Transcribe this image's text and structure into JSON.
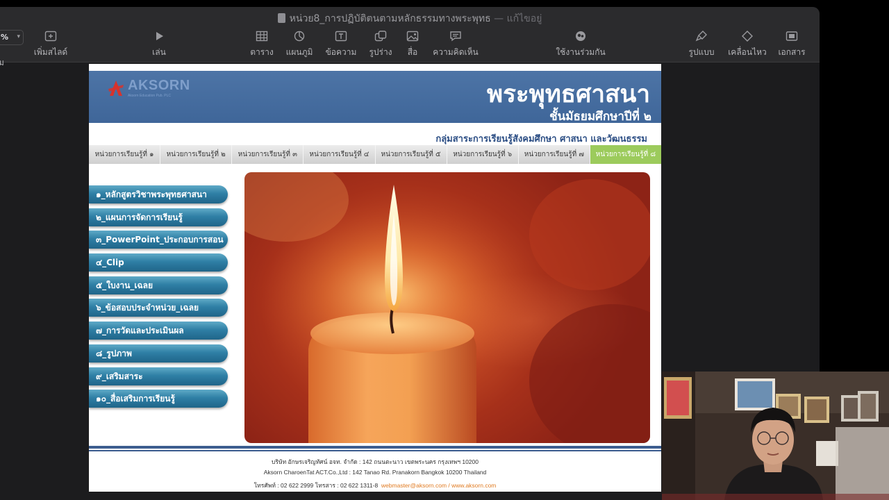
{
  "window": {
    "title": "หน่วย8_การปฏิบัติตนตามหลักธรรมทางพระพุทธ",
    "edited": "— แก้ไขอยู่"
  },
  "toolbar": {
    "zoom_value": "%",
    "zoom_label": "ม",
    "items": [
      {
        "label": "เพิ่มสไลด์",
        "icon": "add-slide-icon"
      },
      {
        "label": "เล่น",
        "icon": "play-icon"
      },
      {
        "label": "ตาราง",
        "icon": "table-icon"
      },
      {
        "label": "แผนภูมิ",
        "icon": "chart-icon"
      },
      {
        "label": "ข้อความ",
        "icon": "text-box-icon"
      },
      {
        "label": "รูปร่าง",
        "icon": "shape-icon"
      },
      {
        "label": "สื่อ",
        "icon": "media-icon"
      },
      {
        "label": "ความคิดเห็น",
        "icon": "comment-icon"
      },
      {
        "label": "ใช้งานร่วมกัน",
        "icon": "collaborate-icon"
      },
      {
        "label": "รูปแบบ",
        "icon": "format-brush-icon"
      },
      {
        "label": "เคลื่อนไหว",
        "icon": "animate-icon"
      },
      {
        "label": "เอกสาร",
        "icon": "document-icon"
      }
    ]
  },
  "slide": {
    "logo": "AKSORN",
    "logo_sub": "Aksorn Education Pub. PLC",
    "title": "พระพุทธศาสนา",
    "subtitle": "ชั้นมัธยมศึกษาปีที่ ๒",
    "group": "กลุ่มสาระการเรียนรู้สังคมศึกษา ศาสนา และวัฒนธรรม",
    "tabs": [
      "หน่วยการเรียนรู้ที่ ๑",
      "หน่วยการเรียนรู้ที่ ๒",
      "หน่วยการเรียนรู้ที่ ๓",
      "หน่วยการเรียนรู้ที่ ๔",
      "หน่วยการเรียนรู้ที่ ๕",
      "หน่วยการเรียนรู้ที่ ๖",
      "หน่วยการเรียนรู้ที่ ๗",
      "หน่วยการเรียนรู้ที่ ๘"
    ],
    "active_tab": 7,
    "menu": [
      "๑_หลักสูตรวิชาพระพุทธศาสนา",
      "๒_แผนการจัดการเรียนรู้",
      "๓_PowerPoint_ประกอบการสอน",
      "๔_Clip",
      "๕_ใบงาน_เฉลย",
      "๖_ข้อสอบประจำหน่วย_เฉลย",
      "๗_การวัดและประเมินผล",
      "๘_รูปภาพ",
      "๙_เสริมสาระ",
      "๑๐_สื่อเสริมการเรียนรู้"
    ],
    "footer": {
      "line1": "บริษัท อักษรเจริญทัศน์ อจท. จำกัด : 142 ถนนตะนาว เขตพระนคร กรุงเทพฯ 10200",
      "line2": "Aksorn CharoenTat ACT.Co.,Ltd : 142 Tanao Rd. Pranakorn Bangkok 10200 Thailand",
      "line3": "โทรศัพท์ : 02 622 2999  โทรสาร : 02 622 1311-8",
      "links": "webmaster@aksorn.com / www.aksorn.com"
    }
  },
  "colors": {
    "banner": "#456d9f",
    "active_tab": "#9ccb5c",
    "menu_button": "#2f7fa5",
    "footer_rule": "#3c5d8f"
  }
}
